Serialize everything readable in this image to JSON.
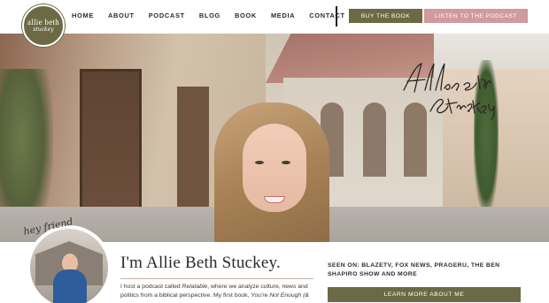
{
  "logo": {
    "line1": "allie beth",
    "line2": "stuckey"
  },
  "nav": {
    "items": [
      {
        "label": "HOME"
      },
      {
        "label": "ABOUT"
      },
      {
        "label": "PODCAST"
      },
      {
        "label": "BLOG"
      },
      {
        "label": "BOOK"
      },
      {
        "label": "MEDIA"
      },
      {
        "label": "CONTACT"
      }
    ],
    "buy_button": "BUY THE BOOK",
    "listen_button": "LISTEN TO THE PODCAST"
  },
  "hero": {
    "signature": "Allie Beth Stuckey"
  },
  "about": {
    "script": "hey friend",
    "title": "I'm Allie Beth Stuckey.",
    "text_a": "I host a podcast called ",
    "text_b": "Relatable",
    "text_c": ", where we analyze culture, news and politics from a biblical perspective. My first book, ",
    "text_d": "You're Not Enough (&"
  },
  "seen_on": {
    "text": "SEEN ON: BLAZETV, FOX NEWS, PRAGERU, THE BEN SHAPIRO SHOW AND MORE"
  },
  "learn_button": "LEARN MORE ABOUT ME",
  "colors": {
    "olive": "#6b6a44",
    "rose": "#d19a9c",
    "text": "#2e2a26"
  }
}
